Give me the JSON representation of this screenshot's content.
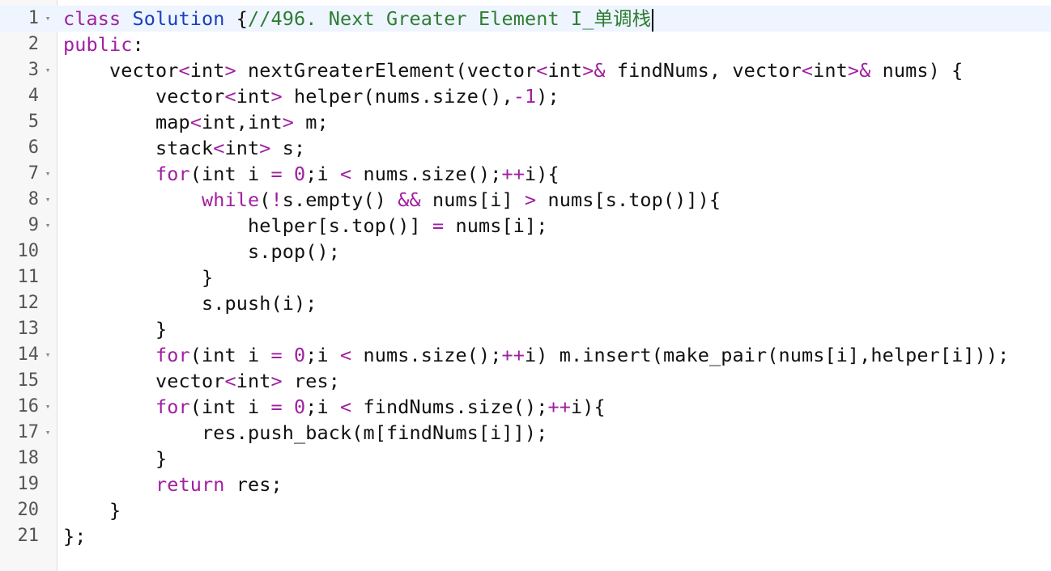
{
  "editor": {
    "colors": {
      "keyword": "#a020a0",
      "type": "#1a3fc0",
      "comment": "#2e7d32",
      "number": "#a020a0",
      "text": "#111111",
      "gutter_bg": "#f7f7f7",
      "line_number": "#555555"
    },
    "fold_glyph": "▾",
    "active_line": 1,
    "lines": [
      {
        "n": "1",
        "fold": true,
        "tokens": [
          [
            "class",
            "kw"
          ],
          [
            " ",
            "t"
          ],
          [
            "Solution",
            "ty"
          ],
          [
            " {",
            "t"
          ],
          [
            "//496. Next Greater Element I_单调栈",
            "cm"
          ]
        ],
        "caret": true
      },
      {
        "n": "2",
        "fold": false,
        "tokens": [
          [
            "public",
            "kw"
          ],
          [
            ":",
            "t"
          ]
        ]
      },
      {
        "n": "3",
        "fold": true,
        "tokens": [
          [
            "    vector",
            "t"
          ],
          [
            "<",
            "kw"
          ],
          [
            "int",
            "t"
          ],
          [
            ">",
            "kw"
          ],
          [
            " nextGreaterElement(vector",
            "t"
          ],
          [
            "<",
            "kw"
          ],
          [
            "int",
            "t"
          ],
          [
            ">&",
            "kw"
          ],
          [
            " findNums, vector",
            "t"
          ],
          [
            "<",
            "kw"
          ],
          [
            "int",
            "t"
          ],
          [
            ">&",
            "kw"
          ],
          [
            " nums) {",
            "t"
          ]
        ]
      },
      {
        "n": "4",
        "fold": false,
        "tokens": [
          [
            "        vector",
            "t"
          ],
          [
            "<",
            "kw"
          ],
          [
            "int",
            "t"
          ],
          [
            ">",
            "kw"
          ],
          [
            " helper(nums.size(),",
            "t"
          ],
          [
            "-1",
            "kw"
          ],
          [
            ");",
            "t"
          ]
        ]
      },
      {
        "n": "5",
        "fold": false,
        "tokens": [
          [
            "        map",
            "t"
          ],
          [
            "<",
            "kw"
          ],
          [
            "int,int",
            "t"
          ],
          [
            ">",
            "kw"
          ],
          [
            " m;",
            "t"
          ]
        ]
      },
      {
        "n": "6",
        "fold": false,
        "tokens": [
          [
            "        stack",
            "t"
          ],
          [
            "<",
            "kw"
          ],
          [
            "int",
            "t"
          ],
          [
            ">",
            "kw"
          ],
          [
            " s;",
            "t"
          ]
        ]
      },
      {
        "n": "7",
        "fold": true,
        "tokens": [
          [
            "        ",
            "t"
          ],
          [
            "for",
            "kw"
          ],
          [
            "(int i ",
            "t"
          ],
          [
            "=",
            "kw"
          ],
          [
            " ",
            "t"
          ],
          [
            "0",
            "kw"
          ],
          [
            ";i ",
            "t"
          ],
          [
            "<",
            "kw"
          ],
          [
            " nums.size();",
            "t"
          ],
          [
            "++",
            "kw"
          ],
          [
            "i){",
            "t"
          ]
        ]
      },
      {
        "n": "8",
        "fold": true,
        "tokens": [
          [
            "            ",
            "t"
          ],
          [
            "while",
            "kw"
          ],
          [
            "(",
            "t"
          ],
          [
            "!",
            "kw"
          ],
          [
            "s.empty() ",
            "t"
          ],
          [
            "&&",
            "kw"
          ],
          [
            " nums[i] ",
            "t"
          ],
          [
            ">",
            "kw"
          ],
          [
            " nums[s.top()]){",
            "t"
          ]
        ]
      },
      {
        "n": "9",
        "fold": true,
        "tokens": [
          [
            "                helper[s.top()] ",
            "t"
          ],
          [
            "=",
            "kw"
          ],
          [
            " nums[i];",
            "t"
          ]
        ]
      },
      {
        "n": "10",
        "fold": false,
        "tokens": [
          [
            "                s.pop();",
            "t"
          ]
        ]
      },
      {
        "n": "11",
        "fold": false,
        "tokens": [
          [
            "            }",
            "t"
          ]
        ]
      },
      {
        "n": "12",
        "fold": false,
        "tokens": [
          [
            "            s.push(i);",
            "t"
          ]
        ]
      },
      {
        "n": "13",
        "fold": false,
        "tokens": [
          [
            "        }",
            "t"
          ]
        ]
      },
      {
        "n": "14",
        "fold": true,
        "tokens": [
          [
            "        ",
            "t"
          ],
          [
            "for",
            "kw"
          ],
          [
            "(int i ",
            "t"
          ],
          [
            "=",
            "kw"
          ],
          [
            " ",
            "t"
          ],
          [
            "0",
            "kw"
          ],
          [
            ";i ",
            "t"
          ],
          [
            "<",
            "kw"
          ],
          [
            " nums.size();",
            "t"
          ],
          [
            "++",
            "kw"
          ],
          [
            "i) m.insert(make_pair(nums[i],helper[i]));",
            "t"
          ]
        ]
      },
      {
        "n": "15",
        "fold": false,
        "tokens": [
          [
            "        vector",
            "t"
          ],
          [
            "<",
            "kw"
          ],
          [
            "int",
            "t"
          ],
          [
            ">",
            "kw"
          ],
          [
            " res;",
            "t"
          ]
        ]
      },
      {
        "n": "16",
        "fold": true,
        "tokens": [
          [
            "        ",
            "t"
          ],
          [
            "for",
            "kw"
          ],
          [
            "(int i ",
            "t"
          ],
          [
            "=",
            "kw"
          ],
          [
            " ",
            "t"
          ],
          [
            "0",
            "kw"
          ],
          [
            ";i ",
            "t"
          ],
          [
            "<",
            "kw"
          ],
          [
            " findNums.size();",
            "t"
          ],
          [
            "++",
            "kw"
          ],
          [
            "i){",
            "t"
          ]
        ]
      },
      {
        "n": "17",
        "fold": true,
        "tokens": [
          [
            "            res.push_back(m[findNums[i]]);",
            "t"
          ]
        ]
      },
      {
        "n": "18",
        "fold": false,
        "tokens": [
          [
            "        }",
            "t"
          ]
        ]
      },
      {
        "n": "19",
        "fold": false,
        "tokens": [
          [
            "        ",
            "t"
          ],
          [
            "return",
            "kw"
          ],
          [
            " res;",
            "t"
          ]
        ]
      },
      {
        "n": "20",
        "fold": false,
        "tokens": [
          [
            "    }",
            "t"
          ]
        ]
      },
      {
        "n": "21",
        "fold": false,
        "tokens": [
          [
            "};",
            "t"
          ]
        ]
      }
    ]
  }
}
